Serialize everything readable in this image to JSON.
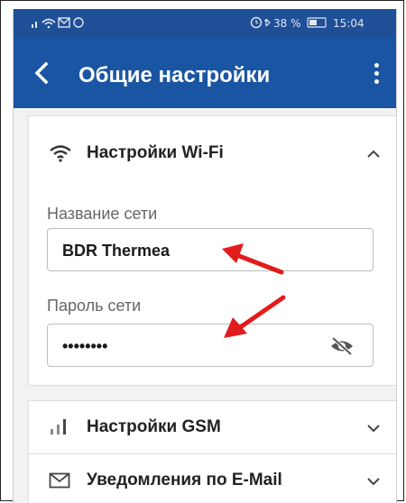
{
  "status": {
    "left": "…‧ ",
    "right": "⏰ ✱ 38 % ▭ 15:04"
  },
  "header": {
    "title": "Общие настройки"
  },
  "wifi": {
    "label": "Настройки Wi-Fi",
    "network_label": "Название сети",
    "network_value": "BDR Thermea",
    "password_label": "Пароль сети",
    "password_value": "••••••••"
  },
  "gsm": {
    "label": "Настройки GSM"
  },
  "email": {
    "label": "Уведомления по E-Mail"
  },
  "colors": {
    "appbar": "#1a55a3",
    "statusbar": "#1f4f96",
    "arrow": "#e21b1b"
  }
}
